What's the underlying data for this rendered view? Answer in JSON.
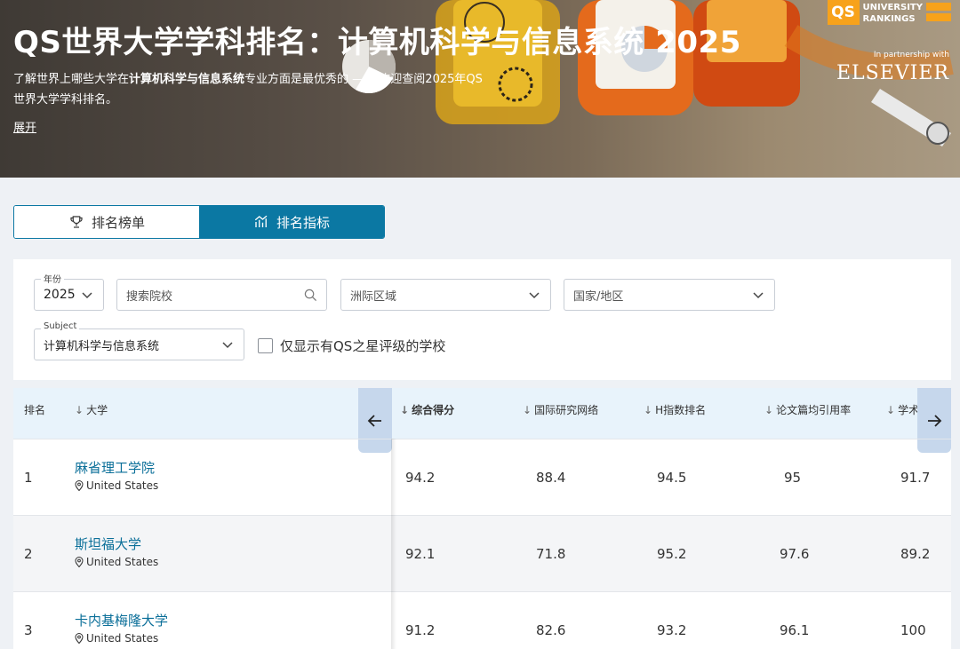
{
  "hero": {
    "title": "QS世界大学学科排名：计算机科学与信息系统 2025",
    "desc_pre": "了解世界上哪些大学在",
    "desc_bold": "计算机科学与信息系统",
    "desc_post": "专业方面是最优秀的 —— 欢迎查阅2025年QS世界大学学科排名。",
    "expand": "展开",
    "logo_badge": "QS",
    "logo_line1": "UNIVERSITY",
    "logo_line2": "RANKINGS",
    "partner": "In partnership with",
    "elsevier": "ELSEVIER",
    "accent": "#f7a21b"
  },
  "tabs": {
    "rankings": "排名榜单",
    "indicators": "排名指标",
    "active": "indicators",
    "active_color": "#0b78a3"
  },
  "filters": {
    "year_legend": "年份",
    "year_value": "2025",
    "search_placeholder": "搜索院校",
    "region_placeholder": "洲际区域",
    "country_placeholder": "国家/地区",
    "subject_legend": "Subject",
    "subject_value": "计算机科学与信息系统",
    "stars_checkbox": "仅显示有QS之星评级的学校"
  },
  "table": {
    "headers": {
      "rank": "排名",
      "university": "大学",
      "overall": "综合得分",
      "irn": "国际研究网络",
      "hindex": "H指数排名",
      "citations": "论文篇均引用率",
      "academic": "学术"
    },
    "rows": [
      {
        "rank": "1",
        "name": "麻省理工学院",
        "location": "United States",
        "overall": "94.2",
        "irn": "88.4",
        "hindex": "94.5",
        "citations": "95",
        "academic": "91.7"
      },
      {
        "rank": "2",
        "name": "斯坦福大学",
        "location": "United States",
        "overall": "92.1",
        "irn": "71.8",
        "hindex": "95.2",
        "citations": "97.6",
        "academic": "89.2"
      },
      {
        "rank": "3",
        "name": "卡内基梅隆大学",
        "location": "United States",
        "overall": "91.2",
        "irn": "82.6",
        "hindex": "93.2",
        "citations": "96.1",
        "academic": "100"
      }
    ]
  },
  "icons": {
    "tab_rankings": "trophy-icon",
    "tab_indicators": "bar-chart-icon",
    "prev": "arrow-left-icon",
    "next": "arrow-right-icon",
    "location": "map-pin-icon",
    "search": "search-icon",
    "dropdown": "chevron-down-icon"
  }
}
